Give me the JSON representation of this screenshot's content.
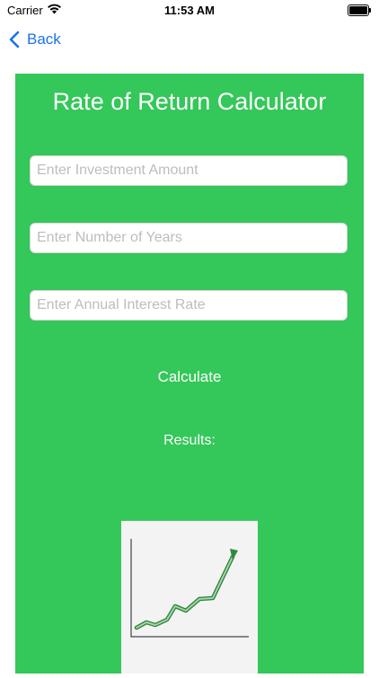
{
  "status_bar": {
    "carrier": "Carrier",
    "time": "11:53 AM"
  },
  "nav": {
    "back_label": "Back",
    "accent_color": "#1a73e8"
  },
  "calculator": {
    "title": "Rate of Return Calculator",
    "background_color": "#34c759",
    "investment_placeholder": "Enter Investment Amount",
    "years_placeholder": "Enter Number of Years",
    "rate_placeholder": "Enter Annual Interest Rate",
    "calculate_label": "Calculate",
    "results_label": "Results:",
    "image_icon": "growth-chart-illustration"
  }
}
